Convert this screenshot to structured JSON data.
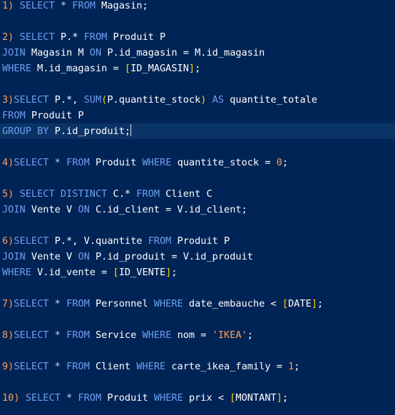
{
  "theme": {
    "background": "#012456",
    "current_line": "#0a3466",
    "keyword": "#6d9ff0",
    "identifier": "#ffffff",
    "number": "#ff9c5a",
    "bracket": "#ffd000"
  },
  "lines": [
    {
      "tokens": [
        {
          "t": "1) ",
          "c": "num"
        },
        {
          "t": "SELECT ",
          "c": "kw"
        },
        {
          "t": "* ",
          "c": "op"
        },
        {
          "t": "FROM ",
          "c": "kw"
        },
        {
          "t": "Magasin;",
          "c": "id"
        }
      ]
    },
    {
      "tokens": []
    },
    {
      "tokens": [
        {
          "t": "2) ",
          "c": "num"
        },
        {
          "t": "SELECT ",
          "c": "kw"
        },
        {
          "t": "P.* ",
          "c": "id"
        },
        {
          "t": "FROM ",
          "c": "kw"
        },
        {
          "t": "Produit P",
          "c": "id"
        }
      ]
    },
    {
      "tokens": [
        {
          "t": "JOIN ",
          "c": "kw"
        },
        {
          "t": "Magasin M ",
          "c": "id"
        },
        {
          "t": "ON ",
          "c": "kw"
        },
        {
          "t": "P.id_magasin = M.id_magasin",
          "c": "id"
        }
      ]
    },
    {
      "tokens": [
        {
          "t": "WHERE ",
          "c": "kw"
        },
        {
          "t": "M.id_magasin = ",
          "c": "id"
        },
        {
          "t": "[",
          "c": "br"
        },
        {
          "t": "ID_MAGASIN",
          "c": "id"
        },
        {
          "t": "]",
          "c": "br"
        },
        {
          "t": ";",
          "c": "id"
        }
      ]
    },
    {
      "tokens": []
    },
    {
      "tokens": [
        {
          "t": "3)",
          "c": "num"
        },
        {
          "t": "SELECT ",
          "c": "kw"
        },
        {
          "t": "P.*, ",
          "c": "id"
        },
        {
          "t": "SUM",
          "c": "kw"
        },
        {
          "t": "(",
          "c": "br"
        },
        {
          "t": "P.quantite_stock",
          "c": "id"
        },
        {
          "t": ")",
          "c": "br"
        },
        {
          "t": " AS ",
          "c": "kw"
        },
        {
          "t": "quantite_totale",
          "c": "id"
        }
      ]
    },
    {
      "tokens": [
        {
          "t": "FROM ",
          "c": "kw"
        },
        {
          "t": "Produit P",
          "c": "id"
        }
      ]
    },
    {
      "current": true,
      "tokens": [
        {
          "t": "GROUP BY ",
          "c": "kw"
        },
        {
          "t": "P.id_produit;",
          "c": "id"
        }
      ]
    },
    {
      "tokens": []
    },
    {
      "tokens": [
        {
          "t": "4)",
          "c": "num"
        },
        {
          "t": "SELECT ",
          "c": "kw"
        },
        {
          "t": "* ",
          "c": "op"
        },
        {
          "t": "FROM ",
          "c": "kw"
        },
        {
          "t": "Produit ",
          "c": "id"
        },
        {
          "t": "WHERE ",
          "c": "kw"
        },
        {
          "t": "quantite_stock = ",
          "c": "id"
        },
        {
          "t": "0",
          "c": "num"
        },
        {
          "t": ";",
          "c": "id"
        }
      ]
    },
    {
      "tokens": []
    },
    {
      "tokens": [
        {
          "t": "5) ",
          "c": "num"
        },
        {
          "t": "SELECT DISTINCT ",
          "c": "kw"
        },
        {
          "t": "C.* ",
          "c": "id"
        },
        {
          "t": "FROM ",
          "c": "kw"
        },
        {
          "t": "Client C",
          "c": "id"
        }
      ]
    },
    {
      "tokens": [
        {
          "t": "JOIN ",
          "c": "kw"
        },
        {
          "t": "Vente V ",
          "c": "id"
        },
        {
          "t": "ON ",
          "c": "kw"
        },
        {
          "t": "C.id_client = V.id_client;",
          "c": "id"
        }
      ]
    },
    {
      "tokens": []
    },
    {
      "tokens": [
        {
          "t": "6)",
          "c": "num"
        },
        {
          "t": "SELECT ",
          "c": "kw"
        },
        {
          "t": "P.*, V.quantite ",
          "c": "id"
        },
        {
          "t": "FROM ",
          "c": "kw"
        },
        {
          "t": "Produit P",
          "c": "id"
        }
      ]
    },
    {
      "tokens": [
        {
          "t": "JOIN ",
          "c": "kw"
        },
        {
          "t": "Vente V ",
          "c": "id"
        },
        {
          "t": "ON ",
          "c": "kw"
        },
        {
          "t": "P.id_produit = V.id_produit",
          "c": "id"
        }
      ]
    },
    {
      "tokens": [
        {
          "t": "WHERE ",
          "c": "kw"
        },
        {
          "t": "V.id_vente = ",
          "c": "id"
        },
        {
          "t": "[",
          "c": "br"
        },
        {
          "t": "ID_VENTE",
          "c": "id"
        },
        {
          "t": "]",
          "c": "br"
        },
        {
          "t": ";",
          "c": "id"
        }
      ]
    },
    {
      "tokens": []
    },
    {
      "tokens": [
        {
          "t": "7)",
          "c": "num"
        },
        {
          "t": "SELECT ",
          "c": "kw"
        },
        {
          "t": "* ",
          "c": "op"
        },
        {
          "t": "FROM ",
          "c": "kw"
        },
        {
          "t": "Personnel ",
          "c": "id"
        },
        {
          "t": "WHERE ",
          "c": "kw"
        },
        {
          "t": "date_embauche < ",
          "c": "id"
        },
        {
          "t": "[",
          "c": "br"
        },
        {
          "t": "DATE",
          "c": "id"
        },
        {
          "t": "]",
          "c": "br"
        },
        {
          "t": ";",
          "c": "id"
        }
      ]
    },
    {
      "tokens": []
    },
    {
      "tokens": [
        {
          "t": "8)",
          "c": "num"
        },
        {
          "t": "SELECT ",
          "c": "kw"
        },
        {
          "t": "* ",
          "c": "op"
        },
        {
          "t": "FROM ",
          "c": "kw"
        },
        {
          "t": "Service ",
          "c": "id"
        },
        {
          "t": "WHERE ",
          "c": "kw"
        },
        {
          "t": "nom = ",
          "c": "id"
        },
        {
          "t": "'IKEA'",
          "c": "str"
        },
        {
          "t": ";",
          "c": "id"
        }
      ]
    },
    {
      "tokens": []
    },
    {
      "tokens": [
        {
          "t": "9)",
          "c": "num"
        },
        {
          "t": "SELECT ",
          "c": "kw"
        },
        {
          "t": "* ",
          "c": "op"
        },
        {
          "t": "FROM ",
          "c": "kw"
        },
        {
          "t": "Client ",
          "c": "id"
        },
        {
          "t": "WHERE ",
          "c": "kw"
        },
        {
          "t": "carte_ikea_family = ",
          "c": "id"
        },
        {
          "t": "1",
          "c": "num"
        },
        {
          "t": ";",
          "c": "id"
        }
      ]
    },
    {
      "tokens": []
    },
    {
      "tokens": [
        {
          "t": "10) ",
          "c": "num"
        },
        {
          "t": "SELECT ",
          "c": "kw"
        },
        {
          "t": "* ",
          "c": "op"
        },
        {
          "t": "FROM ",
          "c": "kw"
        },
        {
          "t": "Produit ",
          "c": "id"
        },
        {
          "t": "WHERE ",
          "c": "kw"
        },
        {
          "t": "prix < ",
          "c": "id"
        },
        {
          "t": "[",
          "c": "br"
        },
        {
          "t": "MONTANT",
          "c": "id"
        },
        {
          "t": "]",
          "c": "br"
        },
        {
          "t": ";",
          "c": "id"
        }
      ]
    }
  ]
}
